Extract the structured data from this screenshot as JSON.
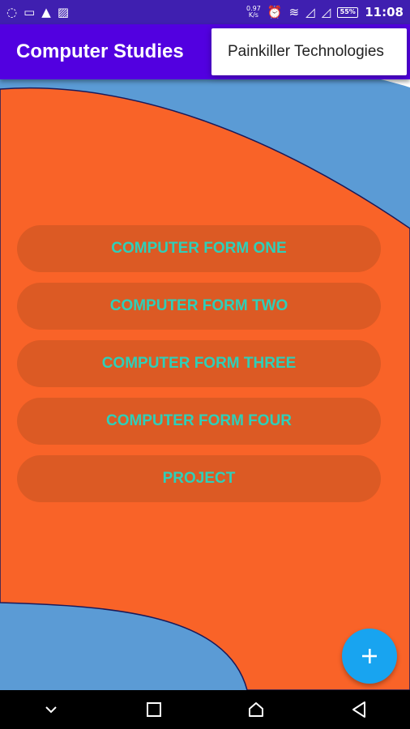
{
  "status_bar": {
    "net_speed_value": "0.97",
    "net_speed_unit": "K/s",
    "battery": "55%",
    "time": "11:08"
  },
  "app_bar": {
    "title": "Computer Studies",
    "overflow_menu_item": "Painkiller Technologies"
  },
  "buttons": [
    {
      "label": "COMPUTER FORM ONE"
    },
    {
      "label": "COMPUTER FORM TWO"
    },
    {
      "label": "COMPUTER FORM THREE"
    },
    {
      "label": "COMPUTER FORM FOUR"
    },
    {
      "label": "PROJECT"
    }
  ],
  "fab": {
    "icon": "plus-icon"
  },
  "colors": {
    "status_bar": "#3f1fb0",
    "app_bar": "#5200e0",
    "background_orange": "#f96328",
    "background_blue": "#5b9bd5",
    "button_bg": "#dc5a24",
    "button_text": "#2fcfb8",
    "fab": "#18a4f0"
  }
}
